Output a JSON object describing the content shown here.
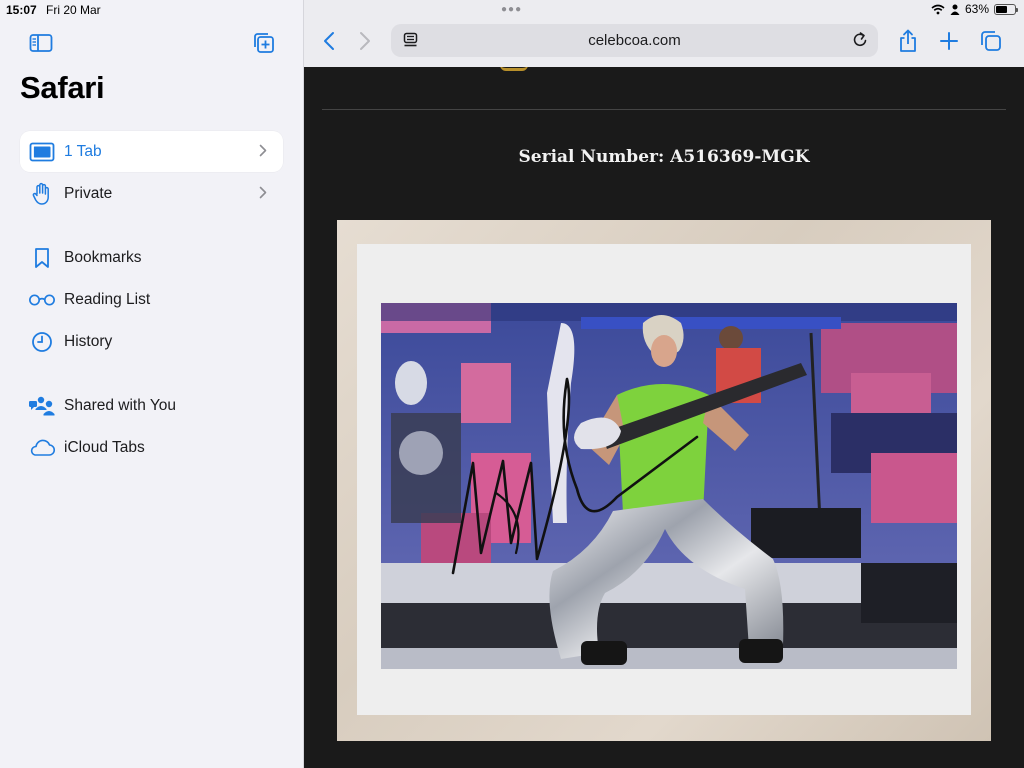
{
  "status": {
    "time": "15:07",
    "date": "Fri 20 Mar",
    "battery_percent": "63%",
    "battery_level": 0.63
  },
  "sidebar": {
    "title": "Safari",
    "items": [
      {
        "label": "1 Tab",
        "icon": "tab-icon",
        "selected": true
      },
      {
        "label": "Private",
        "icon": "hand-icon"
      },
      {
        "label": "Bookmarks",
        "icon": "bookmark-icon"
      },
      {
        "label": "Reading List",
        "icon": "glasses-icon"
      },
      {
        "label": "History",
        "icon": "clock-icon"
      },
      {
        "label": "Shared with You",
        "icon": "shared-people-icon"
      },
      {
        "label": "iCloud Tabs",
        "icon": "cloud-icon"
      }
    ]
  },
  "browser": {
    "url": "celebcoa.com"
  },
  "page": {
    "serial": "Serial Number: A516369-MGK"
  },
  "colors": {
    "accent": "#1f7ce0",
    "sidebar_bg": "#f2f2f7",
    "page_bg": "#1a1a1a",
    "gold": "#b8902b"
  }
}
